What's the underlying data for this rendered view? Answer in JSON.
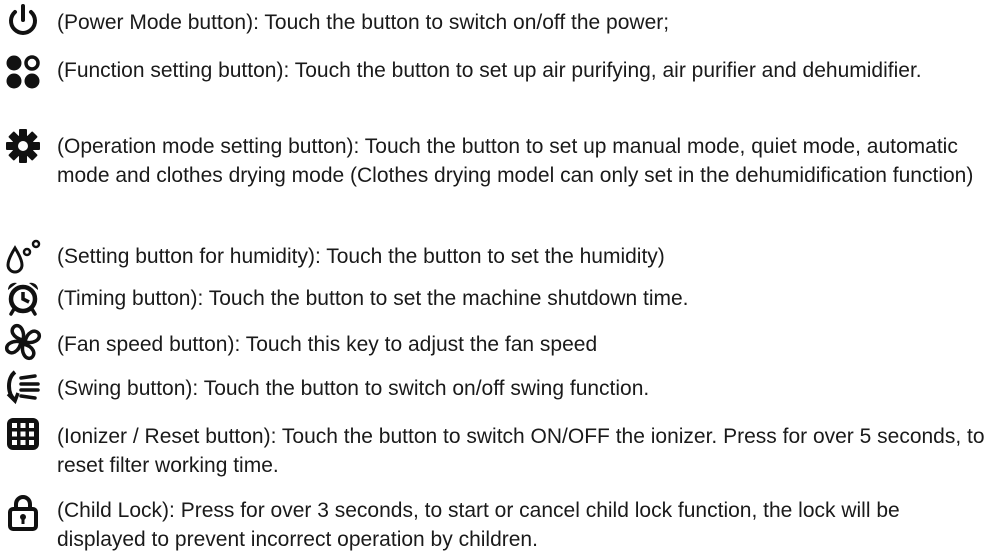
{
  "items": [
    {
      "icon": "power-icon",
      "text": "(Power Mode button): Touch the button to switch on/off the power;"
    },
    {
      "icon": "function-dots-icon",
      "text": "(Function setting button): Touch the button to set up air purifying, air purifier and dehumidifier."
    },
    {
      "icon": "gear-icon",
      "text": "(Operation mode setting button): Touch the button to set up manual mode, quiet mode, automatic mode and clothes drying mode (Clothes drying model can only set in the dehumidification function)"
    },
    {
      "icon": "humidity-drops-icon",
      "text": "(Setting button for humidity): Touch the button to set the humidity)"
    },
    {
      "icon": "alarm-clock-icon",
      "text": "(Timing button): Touch the button to set the machine shutdown time."
    },
    {
      "icon": "fan-icon",
      "text": "(Fan speed button): Touch this key to adjust the fan speed"
    },
    {
      "icon": "swing-icon",
      "text": "(Swing button): Touch the button to switch on/off swing function."
    },
    {
      "icon": "grid-icon",
      "text": "(Ionizer / Reset button): Touch the button to switch ON/OFF the ionizer. Press for over 5 seconds, to reset filter working time."
    },
    {
      "icon": "child-lock-icon",
      "text": "(Child Lock): Press for over 3 seconds, to start or cancel child lock function, the lock will be displayed to prevent incorrect operation by children."
    }
  ]
}
